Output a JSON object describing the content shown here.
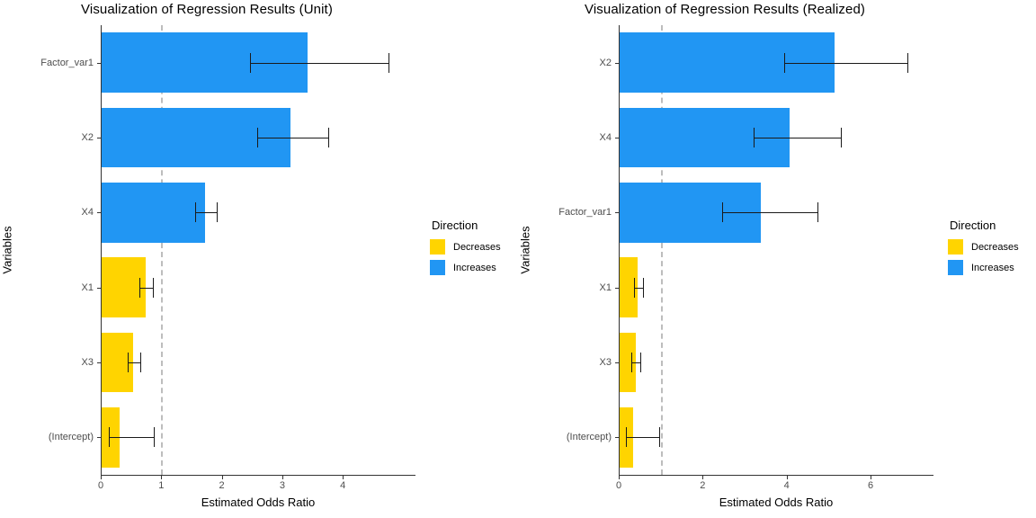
{
  "colors": {
    "increases": "#2196f3",
    "decreases": "#ffd400",
    "refline": "#bdbdbd",
    "axis": "#333333",
    "tick_text": "#4d4d4d"
  },
  "legend": {
    "title": "Direction",
    "items": [
      {
        "label": "Decreases",
        "color": "#ffd400"
      },
      {
        "label": "Increases",
        "color": "#2196f3"
      }
    ]
  },
  "chart_data": [
    {
      "type": "bar",
      "orientation": "horizontal",
      "title": "Visualization of Regression Results (Unit)",
      "xlabel": "Estimated Odds Ratio",
      "ylabel": "Variables",
      "xlim": [
        0,
        5.2
      ],
      "xticks": [
        0,
        1,
        2,
        3,
        4
      ],
      "xticklabels": [
        "0",
        "1",
        "2",
        "3",
        "4"
      ],
      "grid": false,
      "reference_line": 1,
      "legend_position": "right",
      "categories": [
        "Factor_var1",
        "X2",
        "X4",
        "X1",
        "X3",
        "(Intercept)"
      ],
      "values": [
        3.42,
        3.14,
        1.72,
        0.74,
        0.53,
        0.31
      ],
      "ci_low": [
        2.46,
        2.58,
        1.56,
        0.64,
        0.44,
        0.13
      ],
      "ci_high": [
        4.75,
        3.76,
        1.91,
        0.86,
        0.65,
        0.88
      ],
      "direction": [
        "Increases",
        "Increases",
        "Increases",
        "Decreases",
        "Decreases",
        "Decreases"
      ]
    },
    {
      "type": "bar",
      "orientation": "horizontal",
      "title": "Visualization of Regression Results (Realized)",
      "xlabel": "Estimated Odds Ratio",
      "ylabel": "Variables",
      "xlim": [
        0,
        7.5
      ],
      "xticks": [
        0,
        2,
        4,
        6
      ],
      "xticklabels": [
        "0",
        "2",
        "4",
        "6"
      ],
      "grid": false,
      "reference_line": 1,
      "legend_position": "right",
      "categories": [
        "X2",
        "X4",
        "Factor_var1",
        "X1",
        "X3",
        "(Intercept)"
      ],
      "values": [
        5.15,
        4.08,
        3.38,
        0.45,
        0.4,
        0.34
      ],
      "ci_low": [
        3.95,
        3.22,
        2.46,
        0.36,
        0.31,
        0.18
      ],
      "ci_high": [
        6.88,
        5.29,
        4.73,
        0.57,
        0.52,
        0.96
      ],
      "direction": [
        "Increases",
        "Increases",
        "Increases",
        "Decreases",
        "Decreases",
        "Decreases"
      ]
    }
  ]
}
